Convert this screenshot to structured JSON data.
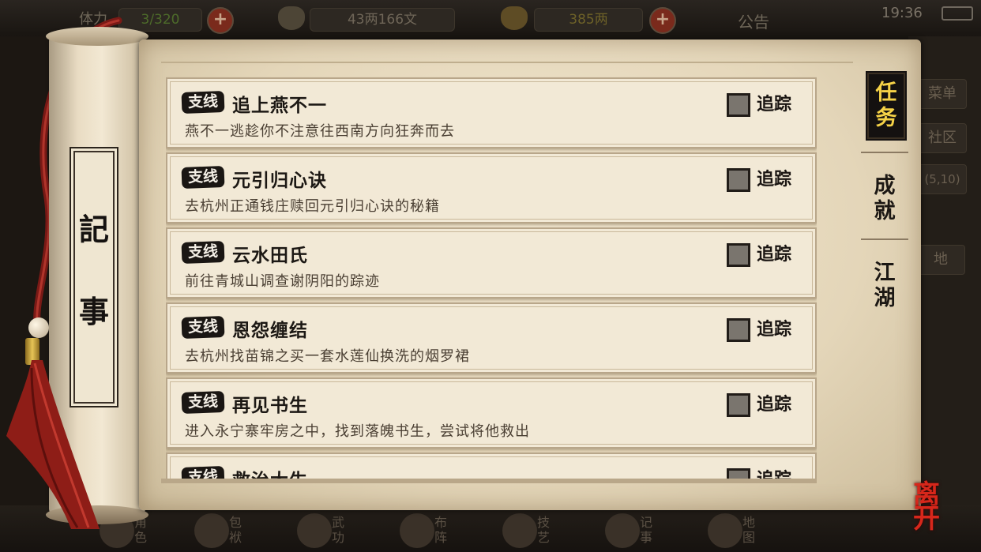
{
  "hud": {
    "stamina_label": "体力",
    "stamina_value": "3/320",
    "money": "43两166文",
    "gold": "385两",
    "notice": "公告",
    "clock": "19:36"
  },
  "right_menu": [
    "菜单",
    "社区",
    "(5,10)",
    "地"
  ],
  "bottom_nav": [
    "角色",
    "包袱",
    "武功",
    "布阵",
    "技艺",
    "记事",
    "地图"
  ],
  "scroll_title": [
    "記",
    "事"
  ],
  "tabs": [
    {
      "label": "任务",
      "active": true
    },
    {
      "label": "成就",
      "active": false
    },
    {
      "label": "江湖",
      "active": false
    }
  ],
  "quest_badge": "支线",
  "track_label": "追踪",
  "quests": [
    {
      "title": "追上燕不一",
      "desc": "燕不一逃趁你不注意往西南方向狂奔而去"
    },
    {
      "title": "元引归心诀",
      "desc": "去杭州正通钱庄赎回元引归心诀的秘籍"
    },
    {
      "title": "云水田氏",
      "desc": "前往青城山调查谢阴阳的踪迹"
    },
    {
      "title": "恩怨缠结",
      "desc": "去杭州找苗锦之买一套水莲仙换洗的烟罗裙"
    },
    {
      "title": "再见书生",
      "desc": "进入永宁寨牢房之中，找到落魄书生，尝试将他救出"
    },
    {
      "title": "救治大生",
      "desc": ""
    }
  ],
  "leave_button": "离开"
}
